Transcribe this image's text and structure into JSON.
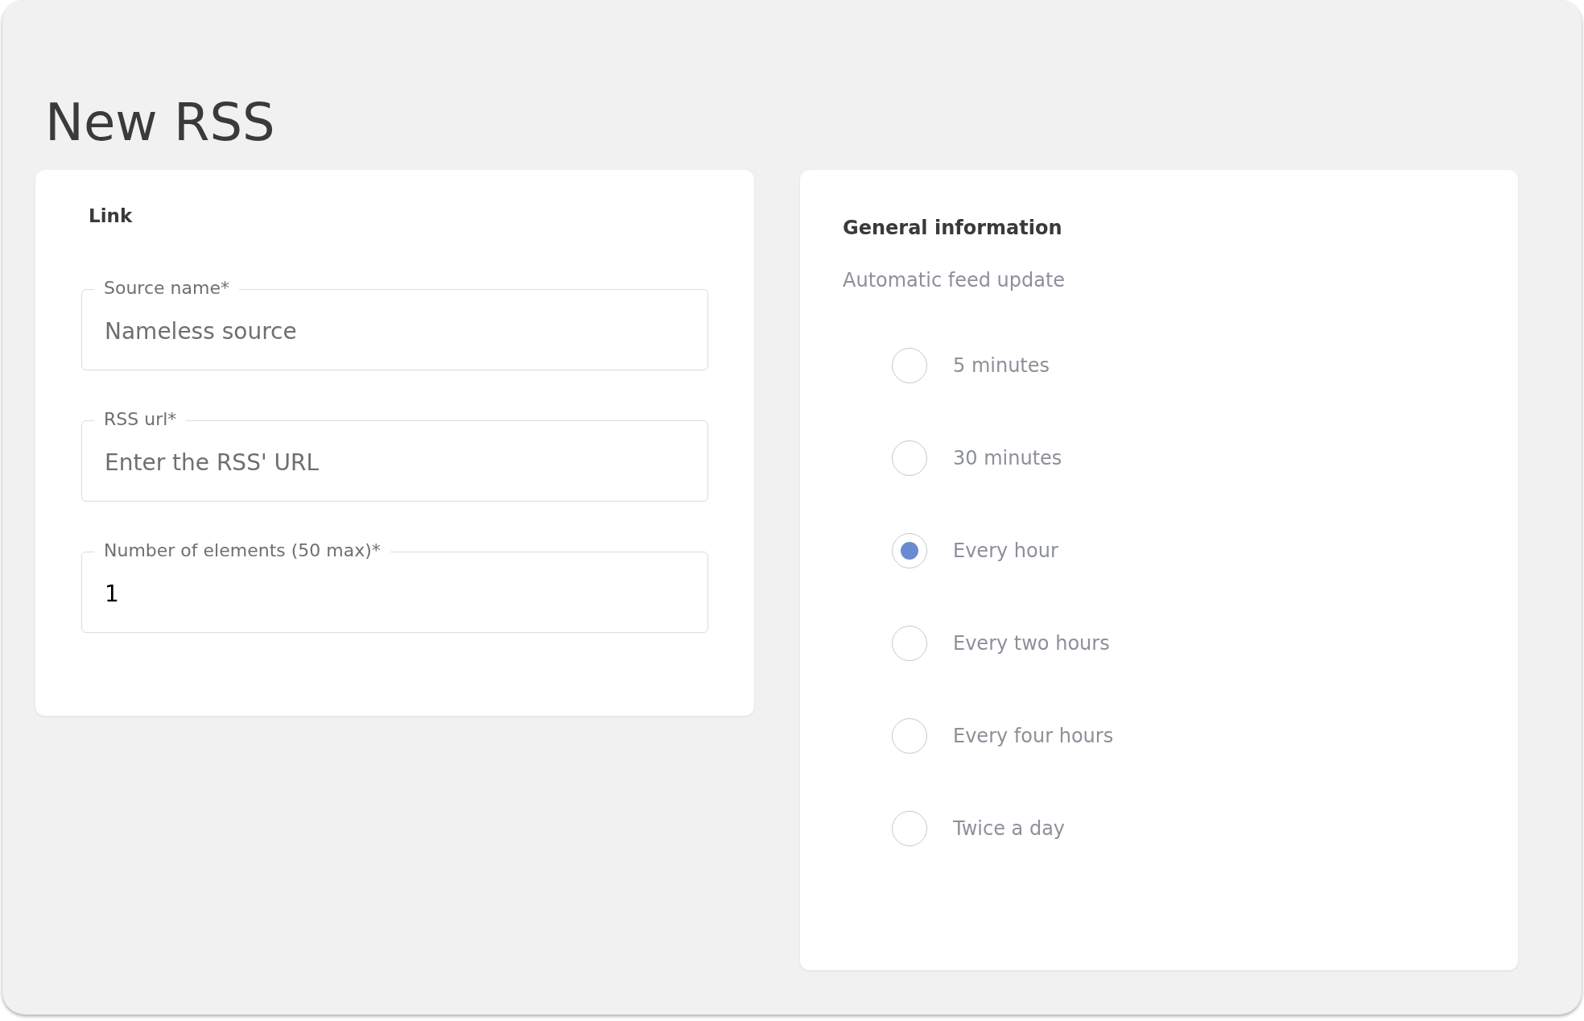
{
  "title": "New RSS",
  "link_card": {
    "heading": "Link",
    "fields": [
      {
        "label": "Source name*",
        "placeholder": "Nameless source"
      },
      {
        "label": "RSS url*",
        "placeholder": "Enter the RSS' URL"
      },
      {
        "label": "Number of elements (50 max)*",
        "value": "1"
      }
    ]
  },
  "general_card": {
    "heading": "General information",
    "subheading": "Automatic feed update",
    "options": [
      {
        "label": "5 minutes",
        "selected": false
      },
      {
        "label": "30 minutes",
        "selected": false
      },
      {
        "label": "Every hour",
        "selected": true
      },
      {
        "label": "Every two hours",
        "selected": false
      },
      {
        "label": "Every four hours",
        "selected": false
      },
      {
        "label": "Twice a day",
        "selected": false
      }
    ]
  }
}
